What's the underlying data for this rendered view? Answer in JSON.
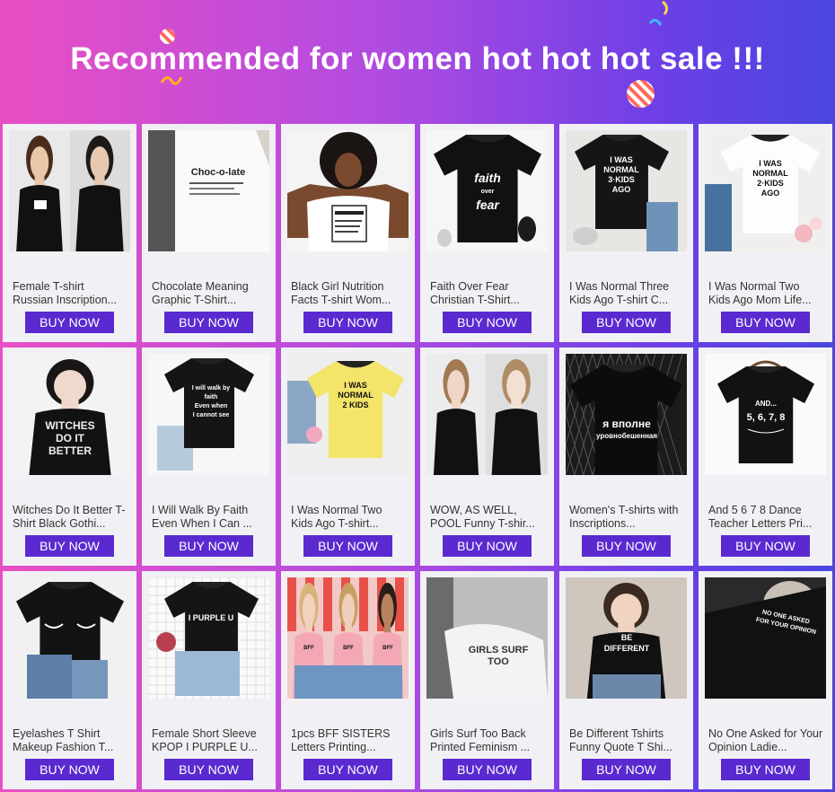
{
  "banner": {
    "title": "Recommended for women hot hot hot sale !!!"
  },
  "colors": {
    "gradient_left": "#e94fc4",
    "gradient_right": "#4a46e0",
    "button": "#5a2ad0",
    "card": "#f1f1f5"
  },
  "products": [
    {
      "name": "Female T-shirt Russian Inscription...",
      "button": "BUY NOW",
      "image": "two-women-black-tees-photo"
    },
    {
      "name": "Chocolate Meaning Graphic T-Shirt...",
      "button": "BUY NOW",
      "image": "white-tee-chocolate-print-photo",
      "print": "Choc-o-late"
    },
    {
      "name": "Black Girl Nutrition Facts T-shirt Wom...",
      "button": "BUY NOW",
      "image": "woman-white-tee-nutrition-facts-photo"
    },
    {
      "name": "Faith Over Fear Christian T-Shirt...",
      "button": "BUY NOW",
      "image": "black-tee-faith-over-fear-flatlay",
      "print": "faith over fear"
    },
    {
      "name": "I Was Normal Three Kids Ago T-shirt C...",
      "button": "BUY NOW",
      "image": "black-tee-3-kids-flatlay",
      "print": "I WAS NORMAL 3 KIDS AGO"
    },
    {
      "name": "I Was Normal Two Kids Ago Mom Life...",
      "button": "BUY NOW",
      "image": "white-tee-2-kids-flatlay",
      "print": "I WAS NORMAL 2 KIDS AGO"
    },
    {
      "name": "Witches Do It Better T-Shirt Black Gothi...",
      "button": "BUY NOW",
      "image": "woman-black-tee-witches-photo",
      "print": "WITCHES DO IT BETTER"
    },
    {
      "name": "I Will Walk By Faith Even When I Can ...",
      "button": "BUY NOW",
      "image": "black-tee-walk-by-faith-flatlay",
      "print": "I will walk by faith even when I cannot see"
    },
    {
      "name": "I Was Normal Two Kids Ago T-shirt...",
      "button": "BUY NOW",
      "image": "yellow-tee-2-kids-flatlay",
      "print": "I WAS NORMAL 2 KIDS AGO"
    },
    {
      "name": "WOW, AS WELL, POOL Funny T-shir...",
      "button": "BUY NOW",
      "image": "two-women-black-tees-photo-2"
    },
    {
      "name": "Women's T-shirts with Inscriptions...",
      "button": "BUY NOW",
      "image": "black-tee-russian-text-flatlay",
      "print": "я вполне уровнобешенная"
    },
    {
      "name": "And 5 6 7 8 Dance Teacher Letters Pri...",
      "button": "BUY NOW",
      "image": "black-tee-hanger-5678",
      "print": "AND... 5, 6, 7, 8"
    },
    {
      "name": "Eyelashes T Shirt Makeup Fashion T...",
      "button": "BUY NOW",
      "image": "black-tee-eyelashes-flatlay"
    },
    {
      "name": "Female Short Sleeve KPOP I PURPLE U...",
      "button": "BUY NOW",
      "image": "black-tee-i-purple-u-flatlay",
      "print": "I PURPLE U"
    },
    {
      "name": "1pcs BFF SISTERS Letters Printing...",
      "button": "BUY NOW",
      "image": "three-women-pink-tees-photo",
      "print": "BFF SISTERS."
    },
    {
      "name": "Girls Surf Too Back Printed Feminism ...",
      "button": "BUY NOW",
      "image": "white-tee-girls-surf-too-photo",
      "print": "GIRLS SURF TOO"
    },
    {
      "name": "Be Different Tshirts Funny Quote T Shi...",
      "button": "BUY NOW",
      "image": "woman-black-tee-be-different-photo",
      "print": "BE DIFFERENT"
    },
    {
      "name": "No One Asked for Your Opinion Ladie...",
      "button": "BUY NOW",
      "image": "woman-black-tee-no-one-asked-photo",
      "print": "NO ONE ASKED FOR YOUR OPINION"
    }
  ]
}
